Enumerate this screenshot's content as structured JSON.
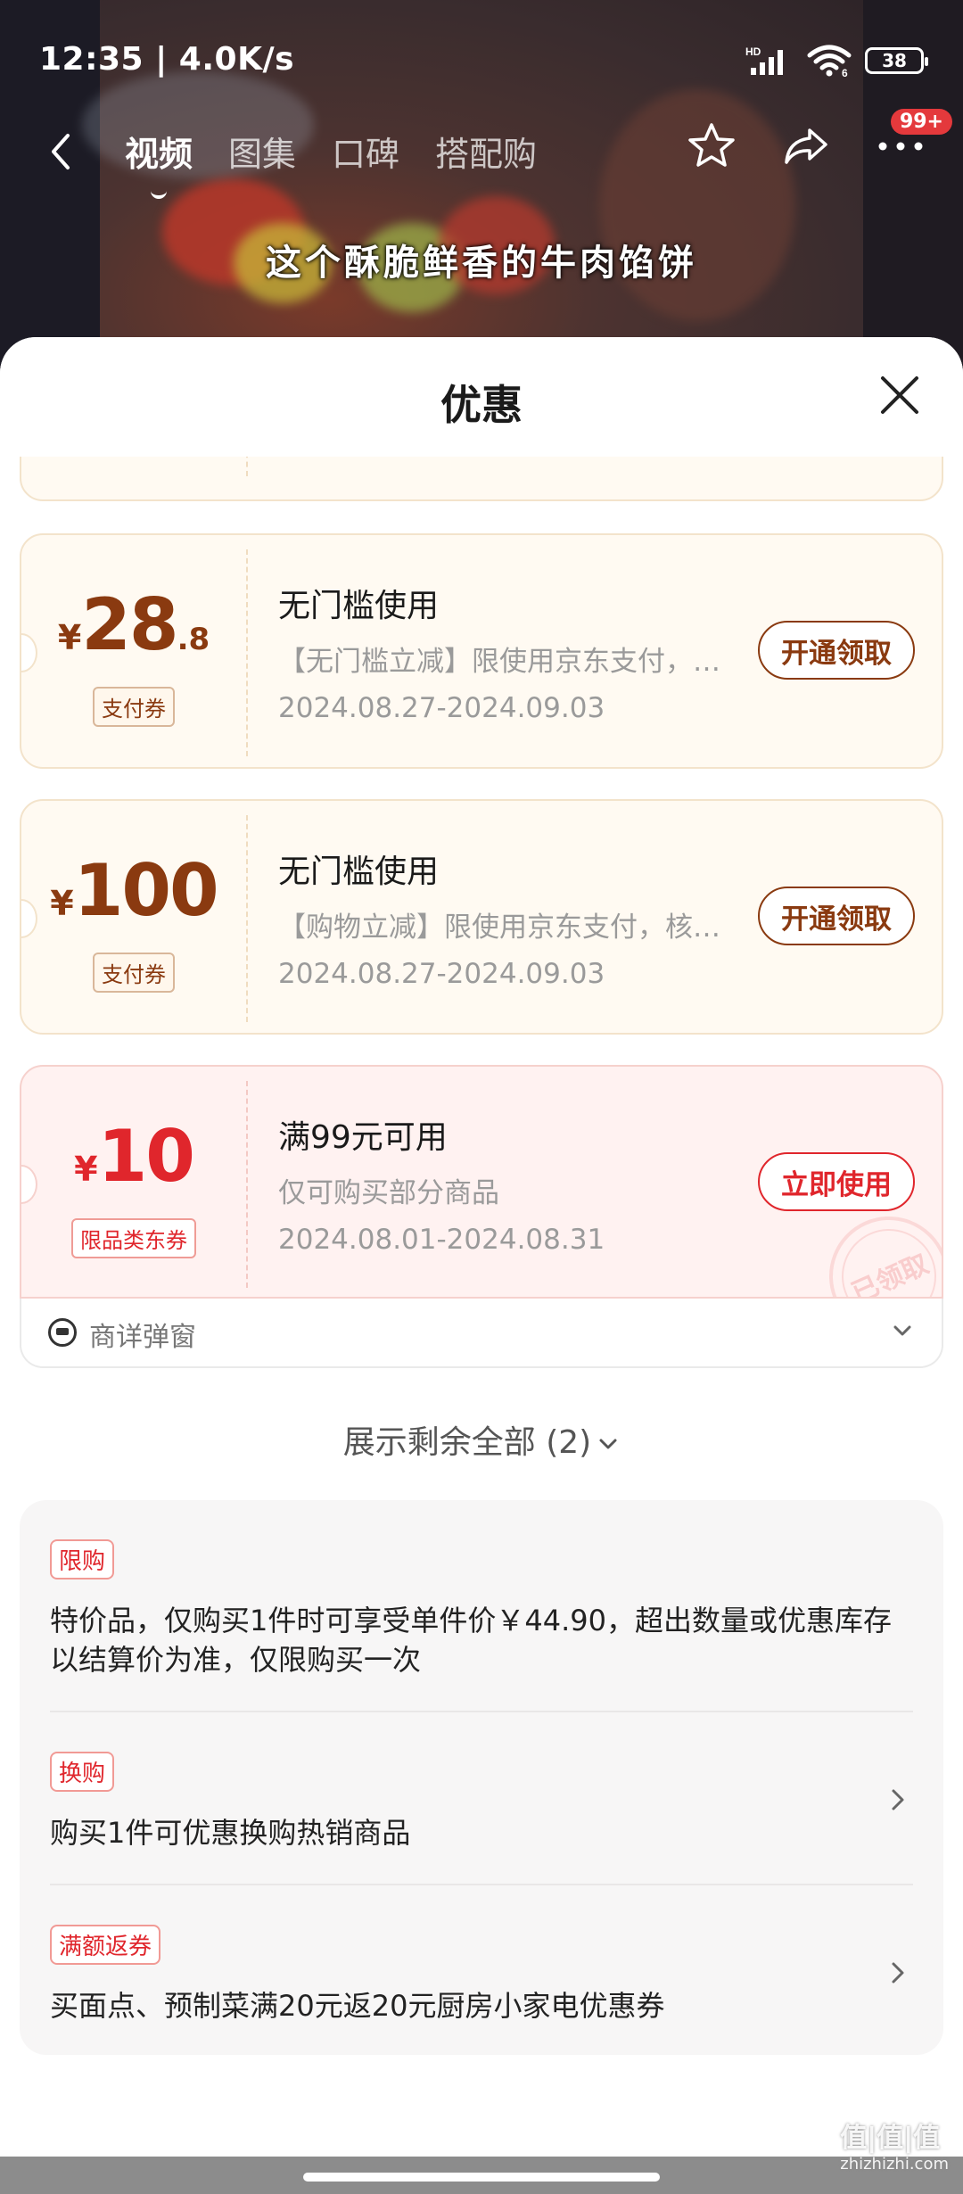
{
  "status": {
    "time": "12:35 | 4.0K/s",
    "battery": "38"
  },
  "nav": {
    "tabs": [
      "视频",
      "图集",
      "口碑",
      "搭配购"
    ],
    "badge": "99+"
  },
  "video": {
    "subtitle": "这个酥脆鲜香的牛肉馅饼"
  },
  "sheet": {
    "title": "优惠"
  },
  "coupons": [
    {
      "yen": "¥",
      "amount_int": "28",
      "amount_dec": ".8",
      "tag": "支付券",
      "title": "无门槛使用",
      "desc": "【无门槛立减】限使用京东支付，核销后不可退",
      "date": "2024.08.27-2024.09.03",
      "button": "开通领取"
    },
    {
      "yen": "¥",
      "amount_int": "100",
      "amount_dec": "",
      "tag": "支付券",
      "title": "无门槛使用",
      "desc": "【购物立减】限使用京东支付，核销后不可退",
      "date": "2024.08.27-2024.09.03",
      "button": "开通领取"
    },
    {
      "yen": "¥",
      "amount_int": "10",
      "amount_dec": "",
      "tag": "限品类东券",
      "title": "满99元可用",
      "desc": "仅可购买部分商品",
      "date": "2024.08.01-2024.08.31",
      "button": "立即使用",
      "stamp": "已领取"
    }
  ],
  "popup_row": {
    "label": "商详弹窗"
  },
  "show_all": "展示剩余全部 (2)",
  "promos": [
    {
      "tag": "限购",
      "text": "特价品，仅购买1件时可享受单件价￥44.90，超出数量或优惠库存以结算价为准，仅限购买一次"
    },
    {
      "tag": "换购",
      "text": "购买1件可优惠换购热销商品"
    },
    {
      "tag": "满额返券",
      "text": "买面点、预制菜满20元返20元厨房小家电优惠券"
    }
  ],
  "watermark": {
    "main": "值|值|值",
    "sub": "zhizhizhi.com"
  },
  "icons": {
    "back": "chevron-left-icon",
    "star": "star-icon",
    "share": "share-icon",
    "more": "more-icon",
    "close": "close-icon",
    "chevron_down": "chevron-down-icon",
    "chevron_right": "chevron-right-icon"
  },
  "colors": {
    "brown_accent": "#8a3a10",
    "red_accent": "#e0262c",
    "coupon_bg": "#fffaf2",
    "coupon_red_bg": "#fff2f1"
  }
}
